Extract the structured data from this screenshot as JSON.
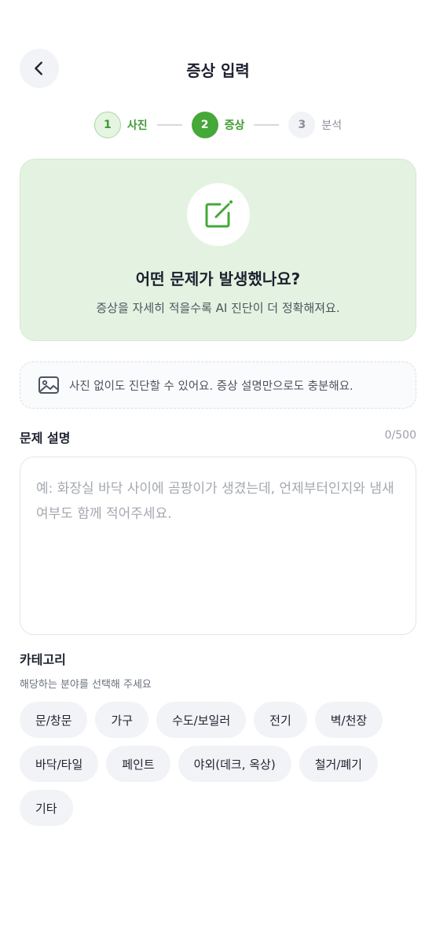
{
  "header": {
    "title": "증상 입력"
  },
  "stepper": {
    "steps": [
      {
        "number": "1",
        "label": "사진",
        "state": "done"
      },
      {
        "number": "2",
        "label": "증상",
        "state": "active"
      },
      {
        "number": "3",
        "label": "분석",
        "state": "todo"
      }
    ]
  },
  "hero": {
    "icon": "edit-icon",
    "title": "어떤 문제가 발생했나요?",
    "subtitle": "증상을 자세히 적을수록 AI 진단이 더 정확해져요."
  },
  "notice": {
    "icon": "image-icon",
    "text": "사진 없이도 진단할 수 있어요. 증상 설명만으로도 충분해요."
  },
  "description": {
    "label": "문제 설명",
    "count": "0/500",
    "value": "",
    "placeholder": "예: 화장실 바닥 사이에 곰팡이가 생겼는데, 언제부터인지와 냄새 여부도 함께 적어주세요."
  },
  "category": {
    "label": "카테고리",
    "hint": "해당하는 분야를 선택해 주세요",
    "options": [
      "문/창문",
      "가구",
      "수도/보일러",
      "전기",
      "벽/천장",
      "바닥/타일",
      "페인트",
      "야외(데크, 옥상)",
      "철거/폐기",
      "기타"
    ]
  },
  "colors": {
    "accent": "#45a838",
    "hero_bg": "#e4f3e1"
  }
}
